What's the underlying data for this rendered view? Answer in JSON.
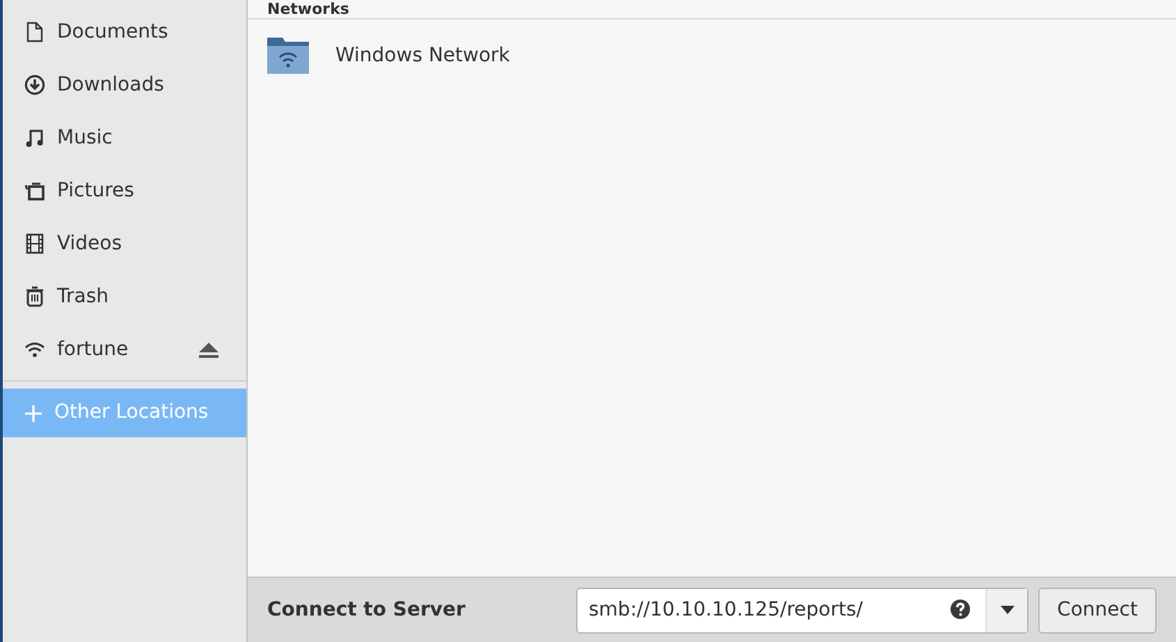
{
  "sidebar": {
    "items": [
      {
        "label": "Documents",
        "kind": "document",
        "ejectable": false,
        "selected": false
      },
      {
        "label": "Downloads",
        "kind": "download",
        "ejectable": false,
        "selected": false
      },
      {
        "label": "Music",
        "kind": "music",
        "ejectable": false,
        "selected": false
      },
      {
        "label": "Pictures",
        "kind": "picture",
        "ejectable": false,
        "selected": false
      },
      {
        "label": "Videos",
        "kind": "video",
        "ejectable": false,
        "selected": false
      },
      {
        "label": "Trash",
        "kind": "trash",
        "ejectable": false,
        "selected": false
      },
      {
        "label": "fortune",
        "kind": "network",
        "ejectable": true,
        "selected": false
      }
    ],
    "other": {
      "label": "Other Locations",
      "selected": true
    }
  },
  "section": {
    "title": "Networks",
    "items": [
      {
        "label": "Windows Network"
      }
    ]
  },
  "connect_bar": {
    "label": "Connect to Server",
    "value": "smb://10.10.10.125/reports/",
    "button": "Connect"
  }
}
